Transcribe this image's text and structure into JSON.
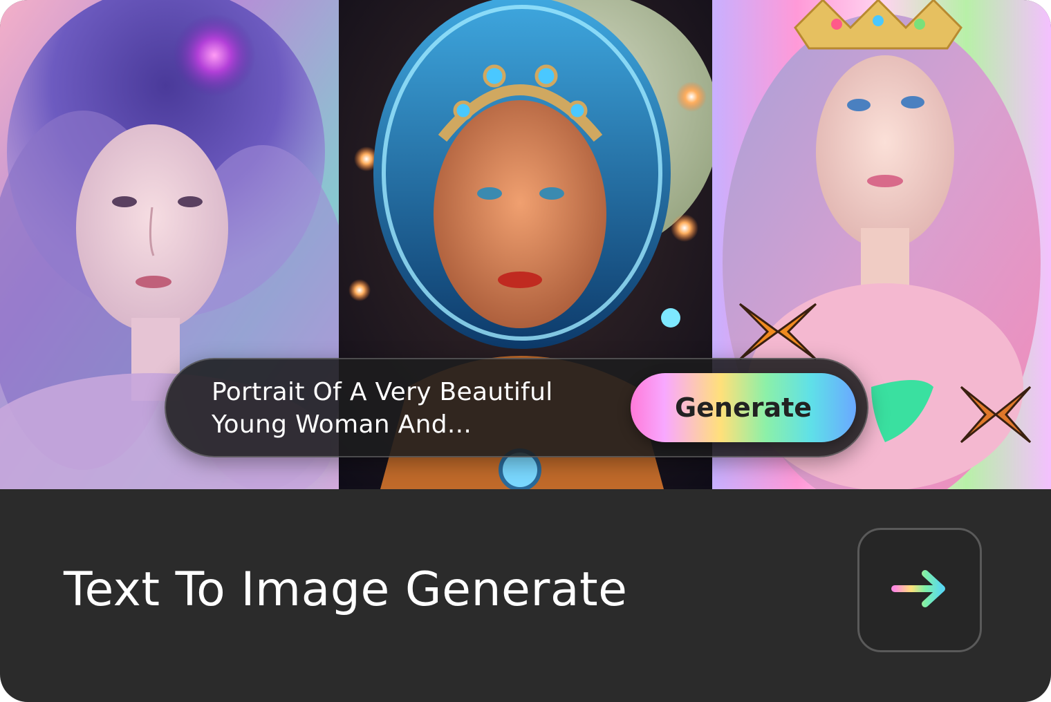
{
  "card": {
    "title": "Text To Image Generate"
  },
  "gallery": {
    "images": [
      {
        "name": "violet-haired-woman-portrait"
      },
      {
        "name": "space-helmet-woman-portrait"
      },
      {
        "name": "rainbow-crown-woman-portrait"
      }
    ]
  },
  "prompt": {
    "text_line1": "Portrait Of A Very Beautiful",
    "text_line2": "Young Woman And...",
    "generate_label": "Generate"
  },
  "icons": {
    "arrow": "arrow-right-icon"
  },
  "colors": {
    "card_background": "#2b2b2b",
    "title_text": "#ffffff",
    "gradient": [
      "#ff7ad9",
      "#ffe07a",
      "#8cf0a8",
      "#5fe0e8",
      "#6aa8ff"
    ]
  }
}
